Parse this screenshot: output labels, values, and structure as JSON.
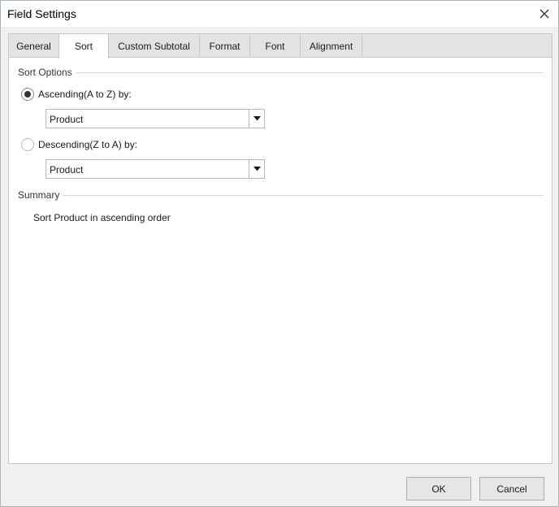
{
  "window": {
    "title": "Field Settings",
    "close_icon": "close-icon"
  },
  "tabs": [
    {
      "label": "General",
      "active": false
    },
    {
      "label": "Sort",
      "active": true
    },
    {
      "label": "Custom Subtotal",
      "active": false
    },
    {
      "label": "Format",
      "active": false
    },
    {
      "label": "Font",
      "active": false
    },
    {
      "label": "Alignment",
      "active": false
    }
  ],
  "sort_options": {
    "group_label": "Sort Options",
    "ascending": {
      "label": "Ascending(A to Z) by:",
      "checked": true,
      "field": "Product"
    },
    "descending": {
      "label": "Descending(Z to A) by:",
      "checked": false,
      "field": "Product"
    }
  },
  "summary": {
    "group_label": "Summary",
    "text": "Sort Product in ascending order"
  },
  "buttons": {
    "ok": "OK",
    "cancel": "Cancel"
  },
  "colors": {
    "panel_bg": "#ffffff",
    "dialog_bg": "#f0f0f0",
    "tab_inactive_bg": "#e3e3e3",
    "border": "#c8c8c8"
  }
}
